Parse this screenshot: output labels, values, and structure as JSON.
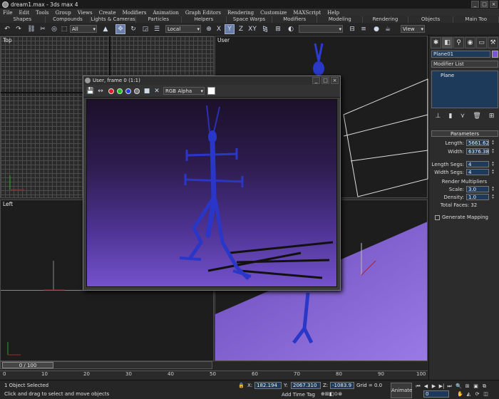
{
  "window": {
    "title": "dream1.max - 3ds max 4"
  },
  "menu": [
    "File",
    "Edit",
    "Tools",
    "Group",
    "Views",
    "Create",
    "Modifiers",
    "Animation",
    "Graph Editors",
    "Rendering",
    "Customize",
    "MAXScript",
    "Help"
  ],
  "tabs": [
    "Shapes",
    "Compounds",
    "Lights & Cameras",
    "Particles",
    "Helpers",
    "Space Warps",
    "Modifiers",
    "Modeling",
    "Rendering",
    "Objects",
    "Main Too"
  ],
  "toolbar": {
    "selection_filter": "All",
    "coord_system": "Local",
    "view_dropdown": "View",
    "axis_x": "X",
    "axis_y": "Y",
    "axis_z": "Z",
    "axis_xy": "XY"
  },
  "viewports": {
    "top": "Top",
    "user": "User",
    "left": "Left"
  },
  "render_window": {
    "title": "User, frame 0 (1:1)",
    "channel": "RGB Alpha"
  },
  "panel": {
    "object_name": "Plane01",
    "object_color": "#7a55d8",
    "modifier_list": "Modifier List",
    "stack_item": "Plane",
    "parameters_title": "Parameters",
    "length_label": "Length:",
    "length_value": "5661.62",
    "width_label": "Width:",
    "width_value": "6376.38",
    "length_segs_label": "Length Segs:",
    "length_segs_value": "4",
    "width_segs_label": "Width Segs:",
    "width_segs_value": "4",
    "render_multipliers": "Render Multipliers",
    "scale_label": "Scale:",
    "scale_value": "3.0",
    "density_label": "Density:",
    "density_value": "1.0",
    "total_faces": "Total Faces: 32",
    "generate_mapping": "Generate Mapping"
  },
  "timeline": {
    "slider": "0 / 100",
    "ticks": [
      "0",
      "10",
      "20",
      "30",
      "40",
      "50",
      "60",
      "70",
      "80",
      "90",
      "100"
    ]
  },
  "status": {
    "selection": "1 Object Selected",
    "prompt": "Click and drag to select and move objects",
    "x_label": "X:",
    "x_value": "182.194",
    "y_label": "Y:",
    "y_value": "2067.310",
    "z_label": "Z:",
    "z_value": "-1083.9",
    "grid": "Grid = 0.0",
    "add_time_tag": "Add Time Tag",
    "animate": "Animate",
    "frame": "0"
  }
}
